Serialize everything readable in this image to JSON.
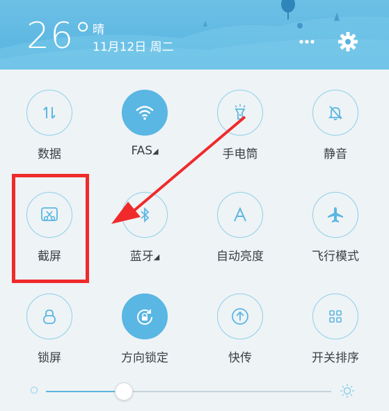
{
  "header": {
    "temperature": "26°",
    "weather": "晴",
    "date": "11月12日 周二",
    "more_icon": "more-icon",
    "settings_icon": "gear-icon"
  },
  "tiles": [
    {
      "label": "数据",
      "icon": "data-arrows-icon",
      "active": false,
      "dropdown": false
    },
    {
      "label": "FAS",
      "icon": "wifi-icon",
      "active": true,
      "dropdown": true
    },
    {
      "label": "手电筒",
      "icon": "flashlight-icon",
      "active": false,
      "dropdown": false
    },
    {
      "label": "静音",
      "icon": "bell-mute-icon",
      "active": false,
      "dropdown": false
    },
    {
      "label": "截屏",
      "icon": "screenshot-scissors-icon",
      "active": false,
      "dropdown": false
    },
    {
      "label": "蓝牙",
      "icon": "bluetooth-icon",
      "active": false,
      "dropdown": true
    },
    {
      "label": "自动亮度",
      "icon": "auto-brightness-icon",
      "active": false,
      "dropdown": false
    },
    {
      "label": "飞行模式",
      "icon": "airplane-icon",
      "active": false,
      "dropdown": false
    },
    {
      "label": "锁屏",
      "icon": "lock-icon",
      "active": false,
      "dropdown": false
    },
    {
      "label": "方向锁定",
      "icon": "rotation-lock-icon",
      "active": true,
      "dropdown": false
    },
    {
      "label": "快传",
      "icon": "quick-transfer-icon",
      "active": false,
      "dropdown": false
    },
    {
      "label": "开关排序",
      "icon": "grid-sort-icon",
      "active": false,
      "dropdown": false
    }
  ],
  "brightness": {
    "level": 0.27
  },
  "dropdown_glyph": "◢",
  "colors": {
    "accent": "#5ab6e2",
    "highlight": "#f02a2a",
    "header": "#56b3e0"
  }
}
